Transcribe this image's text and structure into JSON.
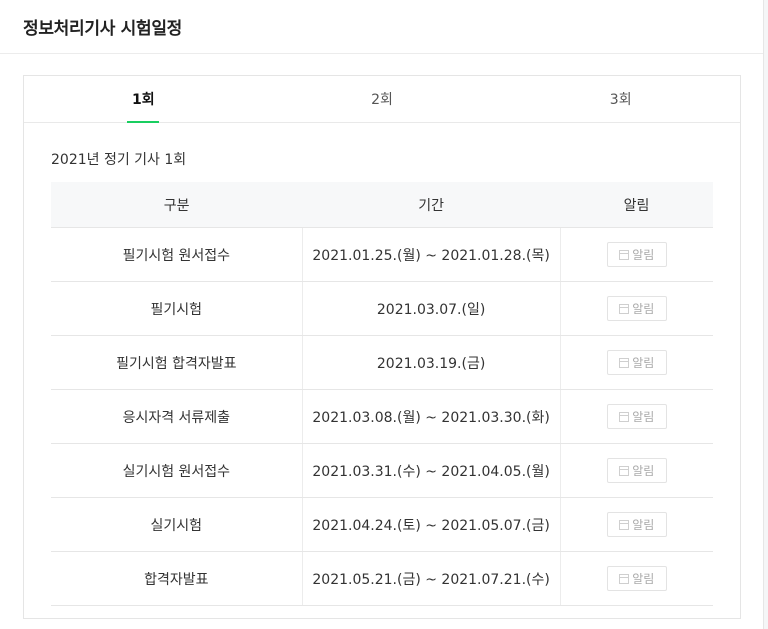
{
  "header": {
    "title": "정보처리기사 시험일정"
  },
  "tabs": [
    {
      "label": "1회",
      "active": true
    },
    {
      "label": "2회",
      "active": false
    },
    {
      "label": "3회",
      "active": false
    }
  ],
  "section": {
    "title": "2021년 정기 기사 1회"
  },
  "table": {
    "columns": [
      "구분",
      "기간",
      "알림"
    ],
    "rows": [
      {
        "category": "필기시험 원서접수",
        "period": "2021.01.25.(월) ~ 2021.01.28.(목)",
        "alarm": "알림"
      },
      {
        "category": "필기시험",
        "period": "2021.03.07.(일)",
        "alarm": "알림"
      },
      {
        "category": "필기시험 합격자발표",
        "period": "2021.03.19.(금)",
        "alarm": "알림"
      },
      {
        "category": "응시자격 서류제출",
        "period": "2021.03.08.(월) ~ 2021.03.30.(화)",
        "alarm": "알림"
      },
      {
        "category": "실기시험 원서접수",
        "period": "2021.03.31.(수) ~ 2021.04.05.(월)",
        "alarm": "알림"
      },
      {
        "category": "실기시험",
        "period": "2021.04.24.(토) ~ 2021.05.07.(금)",
        "alarm": "알림"
      },
      {
        "category": "합격자발표",
        "period": "2021.05.21.(금) ~ 2021.07.21.(수)",
        "alarm": "알림"
      }
    ]
  },
  "colors": {
    "accent": "#19ce60",
    "header_bg": "#f7f8f9",
    "border": "#e6e6e6"
  },
  "icons": {
    "alarm": "calendar-icon"
  }
}
